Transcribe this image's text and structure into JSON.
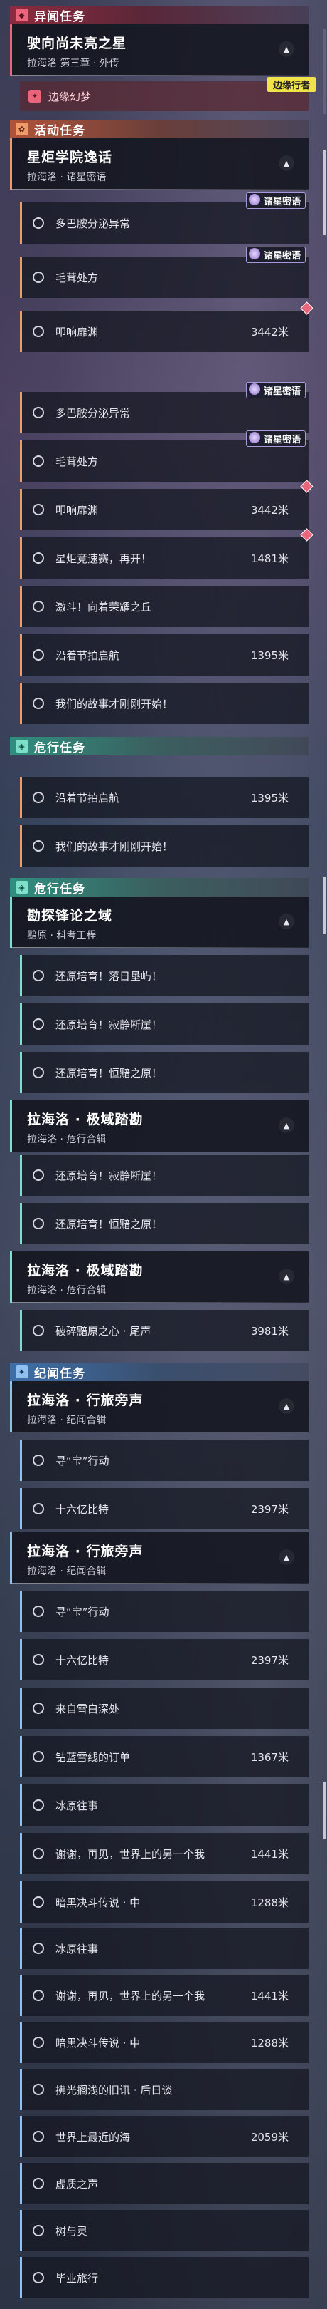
{
  "cat_yiwen": "异闻任务",
  "m_chiyu": {
    "title": "驶向尚未亮之星",
    "sub": "拉海洛 第三章 · 外传"
  },
  "bianyuan": {
    "label": "边缘幻梦",
    "tag": "边缘行者"
  },
  "cat_huodong": "活动任务",
  "m_xingju": {
    "title": "星炬学院逸话",
    "sub": "拉海洛 · 诸星密语"
  },
  "badge_zhuxing": "诸星密语",
  "steps_a": [
    {
      "label": "多巴胺分泌异常",
      "dist": ""
    },
    {
      "label": "毛茸处方",
      "dist": ""
    },
    {
      "label": "叩响扉渊",
      "dist": "3442米"
    }
  ],
  "steps_b": [
    {
      "label": "多巴胺分泌异常",
      "dist": ""
    },
    {
      "label": "毛茸处方",
      "dist": ""
    },
    {
      "label": "叩响扉渊",
      "dist": "3442米"
    },
    {
      "label": "星炬竞速赛，再开！",
      "dist": "1481米"
    },
    {
      "label": "激斗！向着荣耀之丘",
      "dist": ""
    },
    {
      "label": "沿着节拍启航",
      "dist": "1395米"
    },
    {
      "label": "我们的故事才刚刚开始！",
      "dist": ""
    }
  ],
  "cat_weixing": "危行任务",
  "steps_c": [
    {
      "label": "沿着节拍启航",
      "dist": "1395米"
    },
    {
      "label": "我们的故事才刚刚开始！",
      "dist": ""
    }
  ],
  "m_kantan": {
    "title": "勘探锋论之域",
    "sub": "黯原 · 科考工程"
  },
  "steps_d": [
    {
      "label": "还原培育！落日垦屿！",
      "dist": ""
    },
    {
      "label": "还原培育！寂静断崖！",
      "dist": ""
    },
    {
      "label": "还原培育！恒黯之原！",
      "dist": ""
    }
  ],
  "m_jiyu": {
    "title": "拉海洛 · 极域踏勘",
    "sub": "拉海洛 · 危行合辑"
  },
  "steps_e": [
    {
      "label": "还原培育！寂静断崖！",
      "dist": ""
    },
    {
      "label": "还原培育！恒黯之原！",
      "dist": ""
    }
  ],
  "steps_f": [
    {
      "label": "破碎黯原之心 · 尾声",
      "dist": "3981米"
    }
  ],
  "cat_jiwen": "纪闻任务",
  "m_xinglv": {
    "title": "拉海洛 · 行旅旁声",
    "sub": "拉海洛 · 纪闻合辑"
  },
  "steps_g": [
    {
      "label": "寻“宝”行动",
      "dist": ""
    },
    {
      "label": "十六亿比特",
      "dist": "2397米"
    }
  ],
  "steps_h": [
    {
      "label": "寻“宝”行动",
      "dist": ""
    },
    {
      "label": "十六亿比特",
      "dist": "2397米"
    },
    {
      "label": "来自雪白深处",
      "dist": ""
    },
    {
      "label": "钴蓝雪线的订单",
      "dist": "1367米"
    },
    {
      "label": "冰原往事",
      "dist": ""
    },
    {
      "label": "谢谢，再见，世界上的另一个我",
      "dist": "1441米"
    },
    {
      "label": "暗黑决斗传说 · 中",
      "dist": "1288米"
    }
  ],
  "steps_i": [
    {
      "label": "冰原往事",
      "dist": ""
    },
    {
      "label": "谢谢，再见，世界上的另一个我",
      "dist": "1441米"
    },
    {
      "label": "暗黑决斗传说 · 中",
      "dist": "1288米"
    },
    {
      "label": "拂光搁浅的旧讯 · 后日谈",
      "dist": ""
    },
    {
      "label": "世界上最近的海",
      "dist": "2059米"
    },
    {
      "label": "虚质之声",
      "dist": ""
    },
    {
      "label": "树与灵",
      "dist": ""
    },
    {
      "label": "毕业旅行",
      "dist": ""
    }
  ]
}
